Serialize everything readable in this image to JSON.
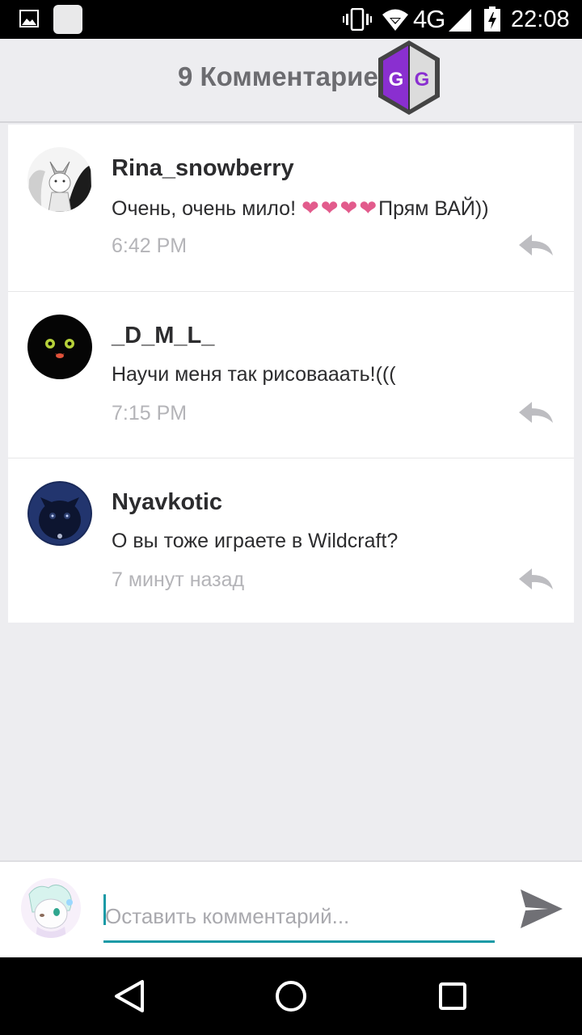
{
  "status_bar": {
    "network_type": "4G",
    "time": "22:08",
    "icons": [
      "gallery-icon",
      "app-square-icon",
      "vibrate-icon",
      "wifi-icon",
      "signal-icon",
      "battery-charging-icon"
    ]
  },
  "header": {
    "title": "9 Комментарие",
    "overlay_icon": "game-guardian-logo-icon",
    "logo_text": "GG"
  },
  "comments": [
    {
      "author": "Rina_snowberry",
      "text_before": "Очень, очень мило! ",
      "hearts": "❤❤❤❤",
      "text_after": "Прям ВАЙ))",
      "time": "6:42 PM",
      "avatar": "fox-drawing-avatar"
    },
    {
      "author": "_D_M_L_",
      "text": "Научи меня так рисовааать!(((",
      "time": "7:15 PM",
      "avatar": "black-creature-avatar"
    },
    {
      "author": "Nyavkotic",
      "text": "О вы тоже играете в Wildcraft?",
      "time": "7 минут назад",
      "avatar": "black-cat-avatar"
    }
  ],
  "compose": {
    "placeholder": "Оставить комментарий...",
    "value": "",
    "accent_color": "#1a9aa6"
  },
  "nav_bar": {
    "icons": [
      "back-icon",
      "home-icon",
      "recents-icon"
    ]
  },
  "colors": {
    "background": "#ededf0",
    "heart": "#e25b8c",
    "logo_purple": "#8a2fd0"
  }
}
